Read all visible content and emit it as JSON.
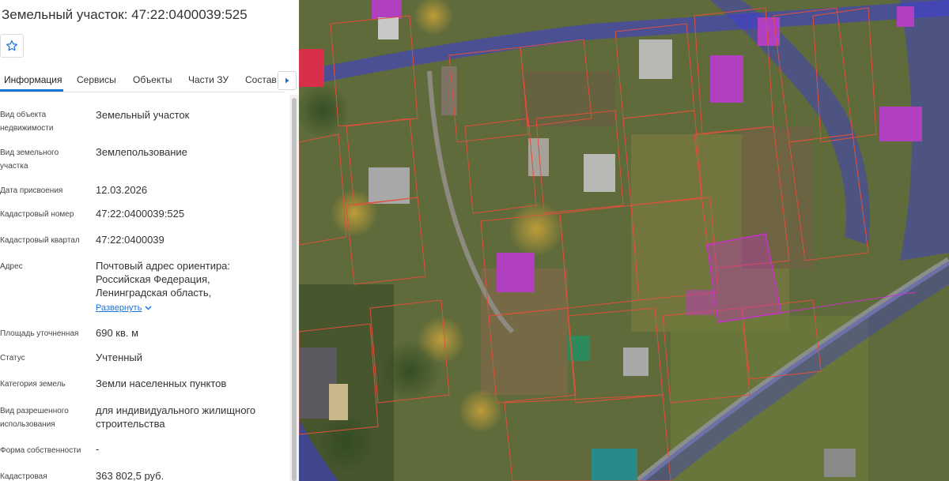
{
  "header": {
    "title": "Земельный участок: 47:22:0400039:525"
  },
  "favorite": {
    "icon": "star-icon"
  },
  "tabs": [
    {
      "label": "Информация",
      "active": true
    },
    {
      "label": "Сервисы",
      "active": false
    },
    {
      "label": "Объекты",
      "active": false
    },
    {
      "label": "Части ЗУ",
      "active": false
    },
    {
      "label": "Состав",
      "active": false
    }
  ],
  "details": [
    {
      "label": "Вид объекта недвижимости",
      "value": "Земельный участок"
    },
    {
      "label": "Вид земельного участка",
      "value": "Землепользование"
    },
    {
      "label": "Дата присвоения",
      "value": "12.03.2026"
    },
    {
      "label": "Кадастровый номер",
      "value": "47:22:0400039:525"
    },
    {
      "label": "Кадастровый квартал",
      "value": "47:22:0400039"
    },
    {
      "label": "Адрес",
      "value": "Почтовый адрес ориентира: Российская Федерация, Ленинградская область,"
    },
    {
      "label": "Площадь уточненная",
      "value": "690 кв. м"
    },
    {
      "label": "Статус",
      "value": "Учтенный"
    },
    {
      "label": "Категория земель",
      "value": "Земли населенных пунктов"
    },
    {
      "label": "Вид разрешенного использования",
      "value": "для индивидуального жилищного строительства"
    },
    {
      "label": "Форма собственности",
      "value": "-"
    },
    {
      "label": "Кадастровая",
      "value": "363 802,5 руб."
    }
  ],
  "address_expand": "Развернуть",
  "colors": {
    "accent": "#1a73d6",
    "selected_parcel": "#c832c8",
    "cadastral_border": "#e0503a",
    "zone_overlay": "#3a3adc"
  }
}
